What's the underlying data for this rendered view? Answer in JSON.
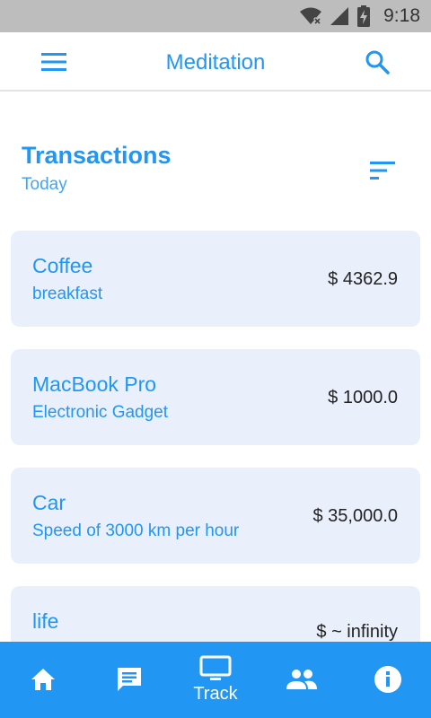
{
  "status_bar": {
    "time": "9:18",
    "icons": [
      "wifi-off-icon",
      "signal-icon",
      "battery-charging-icon"
    ]
  },
  "app_bar": {
    "title": "Meditation",
    "left_icon": "menu-icon",
    "right_icon": "search-icon"
  },
  "section": {
    "title": "Transactions",
    "subtitle": "Today",
    "sort_icon": "sort-icon"
  },
  "transactions": [
    {
      "name": "Coffee",
      "description": "breakfast",
      "amount": "$ 4362.9"
    },
    {
      "name": "MacBook Pro",
      "description": "Electronic Gadget",
      "amount": "$ 1000.0"
    },
    {
      "name": "Car",
      "description": "Speed of 3000 km per hour",
      "amount": "$ 35,000.0"
    },
    {
      "name": "life",
      "description": "",
      "amount": "$ ~ infinity"
    }
  ],
  "bottom_nav": {
    "items": [
      {
        "icon": "home-icon",
        "label": ""
      },
      {
        "icon": "chat-icon",
        "label": ""
      },
      {
        "icon": "monitor-icon",
        "label": "Track",
        "active": true
      },
      {
        "icon": "people-icon",
        "label": ""
      },
      {
        "icon": "info-icon",
        "label": ""
      }
    ]
  },
  "colors": {
    "primary": "#2196f3",
    "card_bg": "#e9f0fc",
    "status_bar": "#bdbdbd"
  }
}
